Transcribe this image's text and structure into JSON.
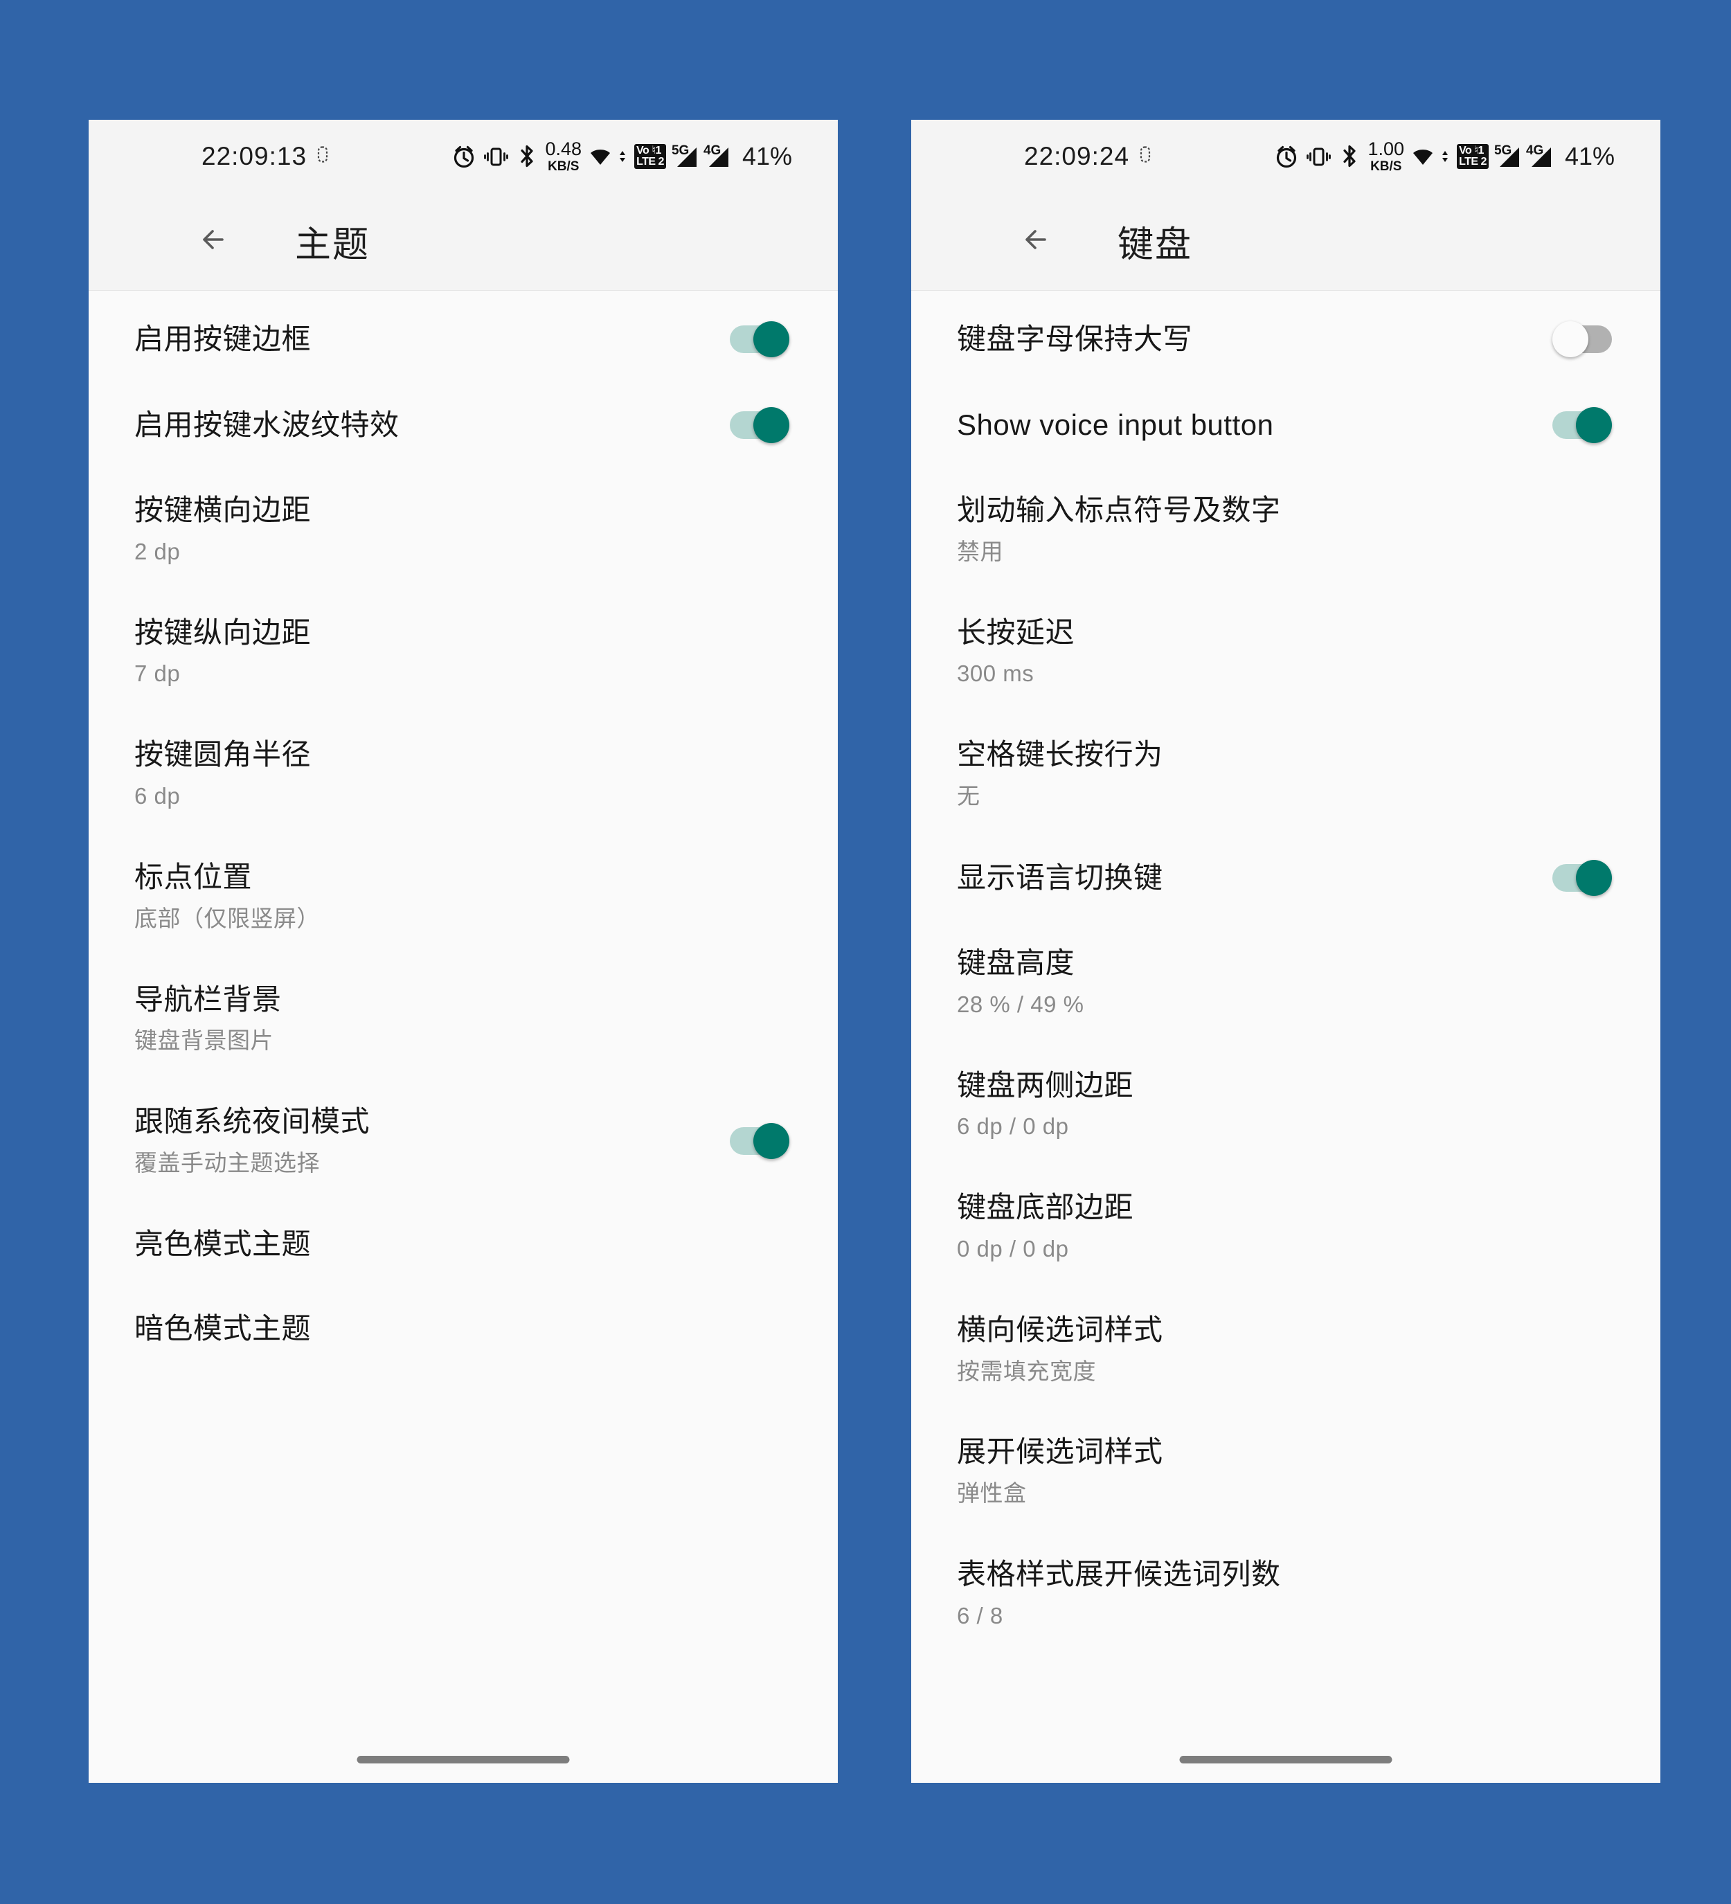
{
  "theme": {
    "background_color": "#3064a8",
    "accent_on_color": "#00796b",
    "accent_track_color": "#b4d6d1",
    "off_track_color": "#b1b1b1"
  },
  "screens": [
    {
      "id": "theme-screen",
      "statusbar": {
        "time": "22:09:13",
        "net_speed_value": "0.48",
        "net_speed_unit": "KB/S",
        "volte_top": "Vo ♮1",
        "volte_bottom": "LTE 2",
        "sim1_label": "5G",
        "sim2_label": "4G",
        "battery": "41%"
      },
      "appbar": {
        "back_label": "←",
        "title": "主题"
      },
      "items": [
        {
          "title": "启用按键边框",
          "sub": null,
          "toggle": "on"
        },
        {
          "title": "启用按键水波纹特效",
          "sub": null,
          "toggle": "on"
        },
        {
          "title": "按键横向边距",
          "sub": "2 dp",
          "toggle": null
        },
        {
          "title": "按键纵向边距",
          "sub": "7 dp",
          "toggle": null
        },
        {
          "title": "按键圆角半径",
          "sub": "6 dp",
          "toggle": null
        },
        {
          "title": "标点位置",
          "sub": "底部（仅限竖屏）",
          "toggle": null
        },
        {
          "title": "导航栏背景",
          "sub": "键盘背景图片",
          "toggle": null
        },
        {
          "title": "跟随系统夜间模式",
          "sub": "覆盖手动主题选择",
          "toggle": "on"
        },
        {
          "title": "亮色模式主题",
          "sub": null,
          "toggle": null
        },
        {
          "title": "暗色模式主题",
          "sub": null,
          "toggle": null
        }
      ]
    },
    {
      "id": "keyboard-screen",
      "statusbar": {
        "time": "22:09:24",
        "net_speed_value": "1.00",
        "net_speed_unit": "KB/S",
        "volte_top": "Vo ♮1",
        "volte_bottom": "LTE 2",
        "sim1_label": "5G",
        "sim2_label": "4G",
        "battery": "41%"
      },
      "appbar": {
        "back_label": "←",
        "title": "键盘"
      },
      "items": [
        {
          "title": "键盘字母保持大写",
          "sub": null,
          "toggle": "off"
        },
        {
          "title": "Show voice input button",
          "sub": null,
          "toggle": "on"
        },
        {
          "title": "划动输入标点符号及数字",
          "sub": "禁用",
          "toggle": null
        },
        {
          "title": "长按延迟",
          "sub": "300 ms",
          "toggle": null
        },
        {
          "title": "空格键长按行为",
          "sub": "无",
          "toggle": null
        },
        {
          "title": "显示语言切换键",
          "sub": null,
          "toggle": "on"
        },
        {
          "title": "键盘高度",
          "sub": "28 % / 49 %",
          "toggle": null
        },
        {
          "title": "键盘两侧边距",
          "sub": "6 dp / 0 dp",
          "toggle": null
        },
        {
          "title": "键盘底部边距",
          "sub": "0 dp / 0 dp",
          "toggle": null
        },
        {
          "title": "横向候选词样式",
          "sub": "按需填充宽度",
          "toggle": null
        },
        {
          "title": "展开候选词样式",
          "sub": "弹性盒",
          "toggle": null
        },
        {
          "title": "表格样式展开候选词列数",
          "sub": "6  / 8",
          "toggle": null
        }
      ]
    }
  ]
}
